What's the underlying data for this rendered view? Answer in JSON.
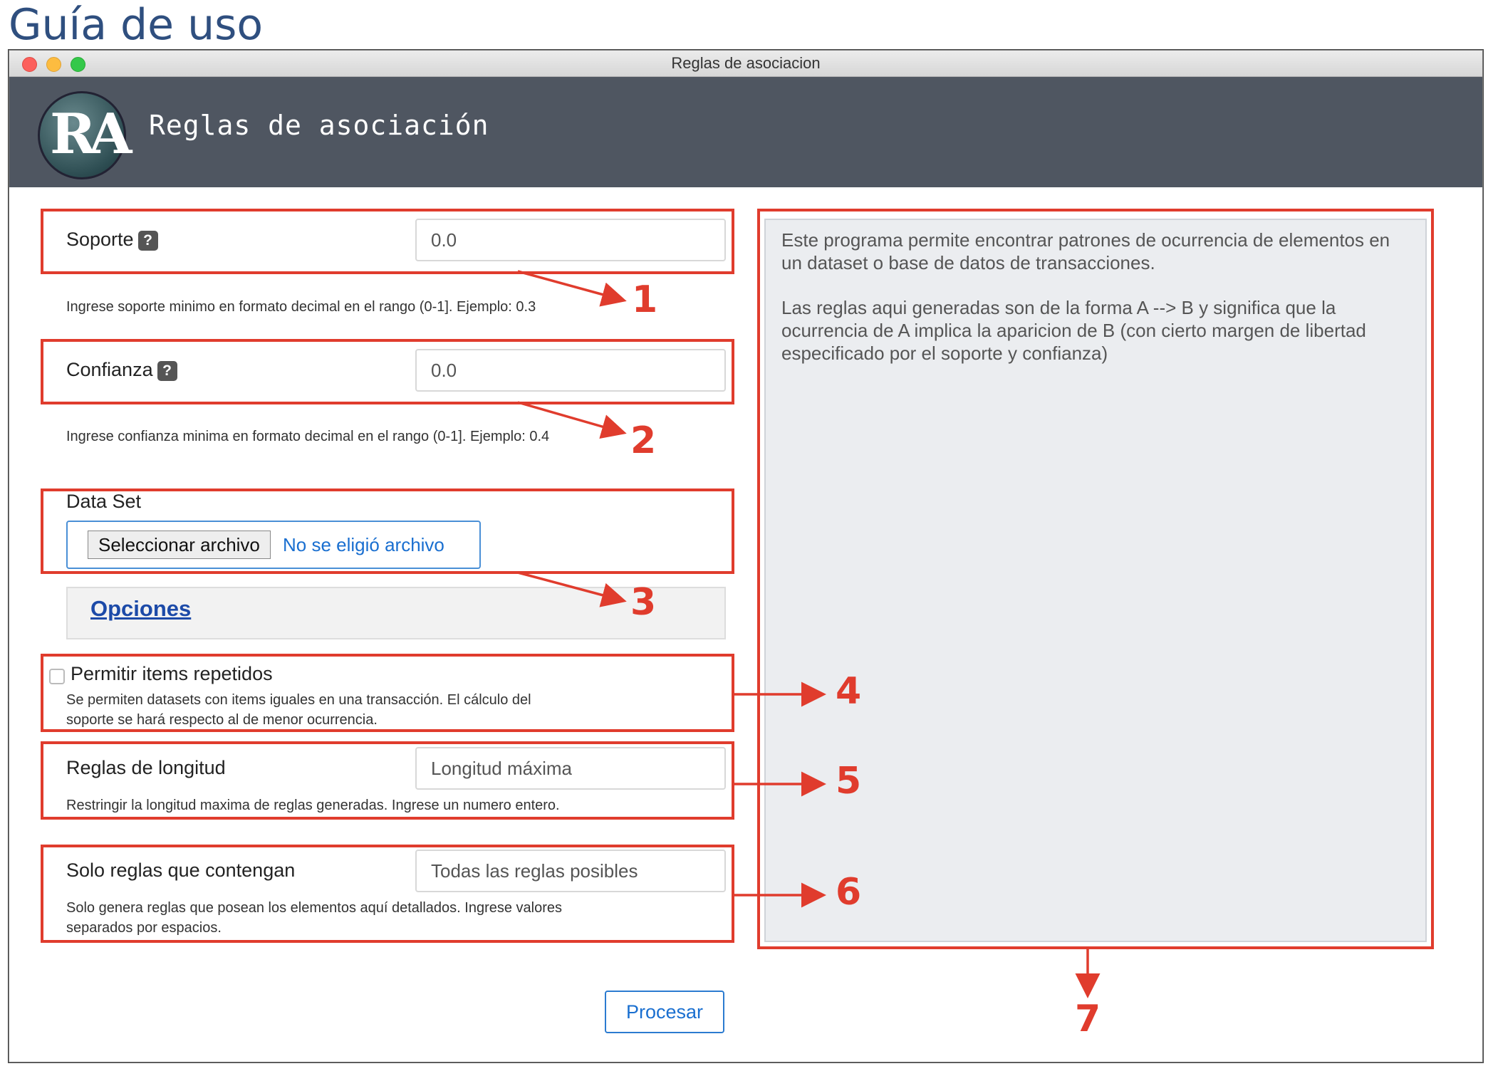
{
  "guide_title": "Guía de uso",
  "window": {
    "title": "Reglas de asociacion"
  },
  "header": {
    "logo_text": "RA",
    "app_title": "Reglas de asociación"
  },
  "form": {
    "soporte": {
      "label": "Soporte",
      "help": "?",
      "value": "0.0",
      "hint": "Ingrese soporte minimo en formato decimal en el rango (0-1]. Ejemplo: 0.3"
    },
    "confianza": {
      "label": "Confianza",
      "help": "?",
      "value": "0.0",
      "hint": "Ingrese confianza minima en formato decimal en el rango (0-1]. Ejemplo: 0.4"
    },
    "dataset": {
      "label": "Data Set",
      "button": "Seleccionar archivo",
      "status": "No se eligió archivo"
    },
    "options_link": "Opciones",
    "repetidos": {
      "label": "Permitir items repetidos",
      "checked": false,
      "hint_line1": "Se permiten datasets con items iguales en una transacción. El cálculo del",
      "hint_line2": "soporte se hará respecto al de menor ocurrencia."
    },
    "longitud": {
      "label": "Reglas de longitud",
      "placeholder": "Longitud máxima",
      "hint": "Restringir la longitud maxima de reglas generadas. Ingrese un numero entero."
    },
    "contengan": {
      "label": "Solo reglas que contengan",
      "placeholder": "Todas las reglas posibles",
      "hint_line1": "Solo genera reglas que posean los elementos aquí detallados. Ingrese valores",
      "hint_line2": "separados por espacios."
    },
    "submit": "Procesar"
  },
  "output": {
    "paragraph1": "Este programa permite encontrar patrones de ocurrencia de elementos en un dataset o base de datos de transacciones.",
    "paragraph2": "Las reglas aqui generadas son de la forma A --> B y significa que la ocurrencia de A implica la aparicion de B (con cierto margen de libertad especificado por el soporte y confianza)"
  },
  "annotations": [
    "1",
    "2",
    "3",
    "4",
    "5",
    "6",
    "7"
  ],
  "colors": {
    "annotation_red": "#e03c2d",
    "header_bg": "#4f5661",
    "link_blue": "#1a6fd0"
  }
}
